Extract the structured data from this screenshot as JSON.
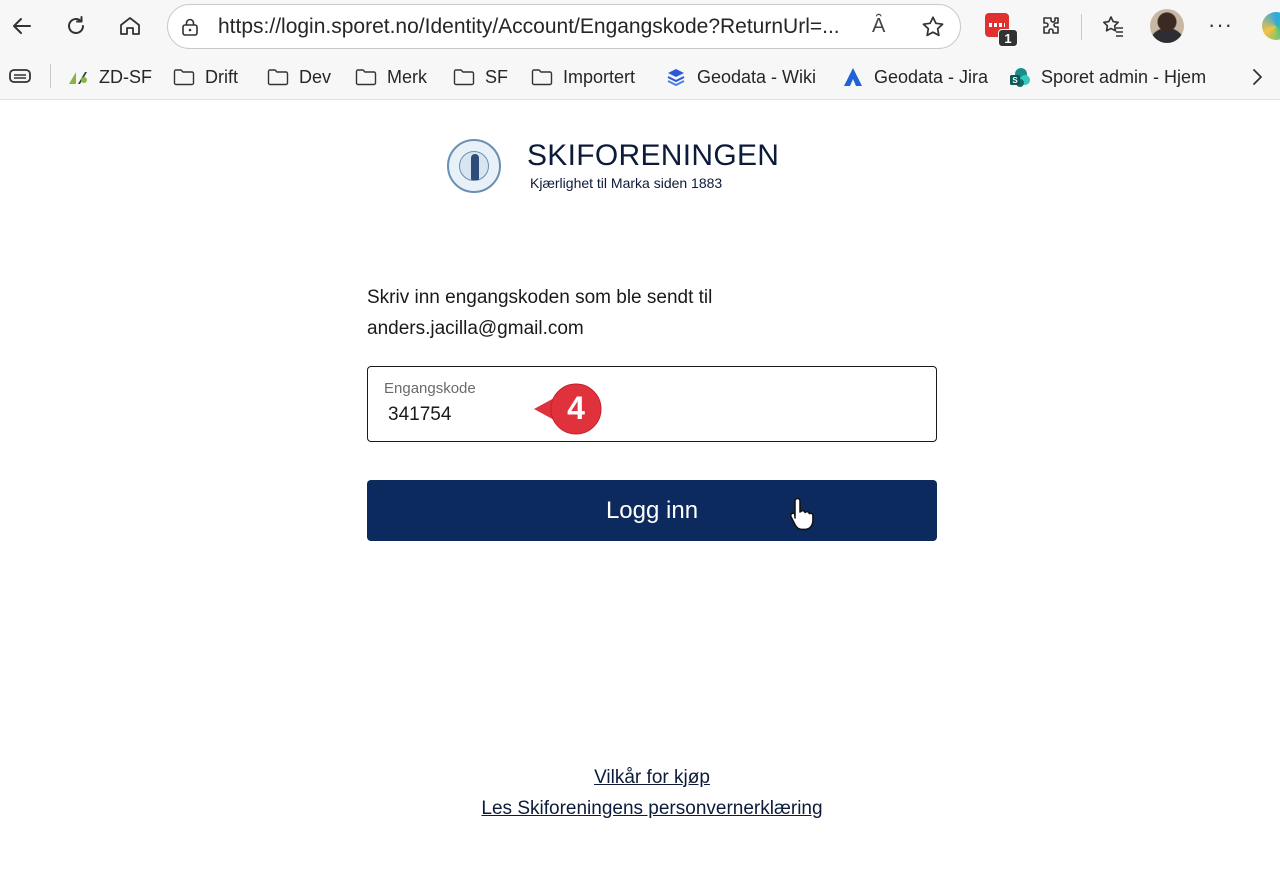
{
  "browser": {
    "url": "https://login.sporet.no/Identity/Account/Engangskode?ReturnUrl=...",
    "read_aloud": "Ȃ",
    "extension_badge": "1"
  },
  "favorites": [
    {
      "label": "ZD-SF",
      "icon": "zendesk-icon"
    },
    {
      "label": "Drift",
      "icon": "folder-icon"
    },
    {
      "label": "Dev",
      "icon": "folder-icon"
    },
    {
      "label": "Merk",
      "icon": "folder-icon"
    },
    {
      "label": "SF",
      "icon": "folder-icon"
    },
    {
      "label": "Importert",
      "icon": "folder-icon"
    },
    {
      "label": "Geodata - Wiki",
      "icon": "confluence-icon"
    },
    {
      "label": "Geodata - Jira",
      "icon": "jira-icon"
    },
    {
      "label": "Sporet admin - Hjem",
      "icon": "sharepoint-icon"
    }
  ],
  "page": {
    "brand": "SKIFORENINGEN",
    "tagline": "Kjærlighet til Marka siden 1883",
    "intro_line1": "Skriv inn engangskoden som ble sendt til",
    "intro_line2": "anders.jacilla@gmail.com",
    "code_label": "Engangskode",
    "code_value": "341754",
    "login_button": "Logg inn",
    "step_number": "4",
    "link_terms": "Vilkår for kjøp",
    "link_privacy": "Les Skiforeningens personvernerklæring"
  },
  "colors": {
    "primary": "#0d2a5e",
    "step_marker": "#e0323c",
    "brand_text": "#0c1b3a"
  }
}
